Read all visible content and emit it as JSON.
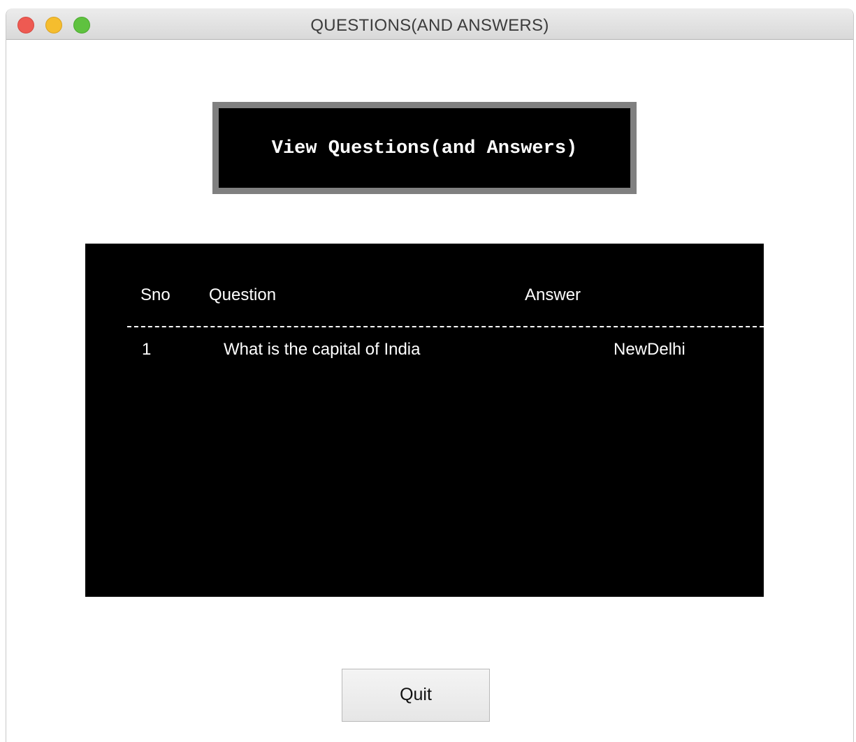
{
  "window": {
    "title": "QUESTIONS(AND ANSWERS)",
    "controls": [
      "close",
      "minimize",
      "zoom"
    ]
  },
  "heading": {
    "text": "View Questions(and Answers)"
  },
  "table": {
    "columns": {
      "sno": "Sno",
      "question": "Question",
      "answer": "Answer"
    },
    "divider": "--------------------------------------------------------------------------------------------------------------------",
    "rows": [
      {
        "sno": "1",
        "question": "What is the capital of India",
        "answer": "NewDelhi"
      }
    ]
  },
  "buttons": {
    "quit": "Quit"
  },
  "colors": {
    "panel_background": "#000000",
    "heading_border": "#808080",
    "text_on_dark": "#ffffff"
  }
}
